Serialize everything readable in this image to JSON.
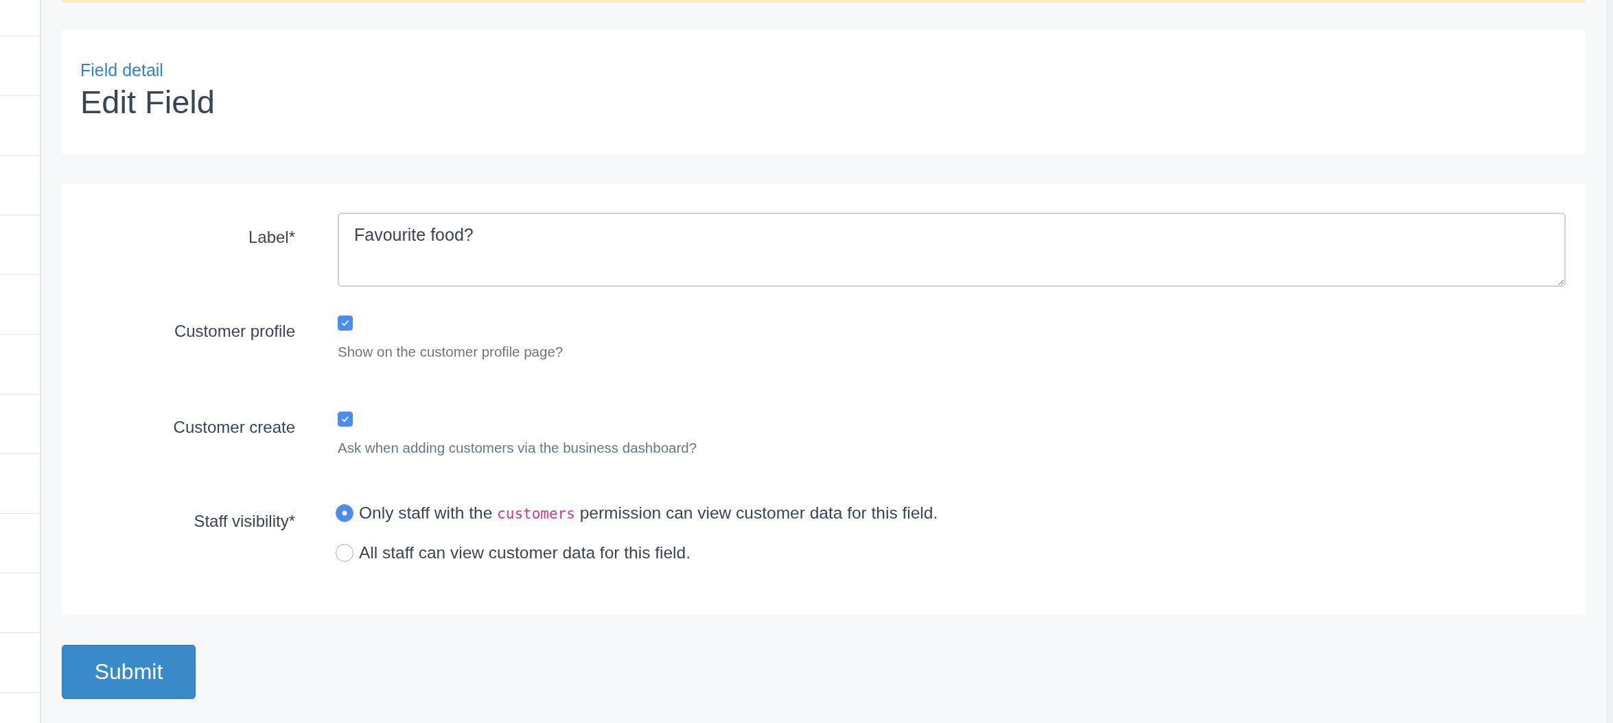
{
  "header": {
    "breadcrumb": "Field detail",
    "title": "Edit Field"
  },
  "form": {
    "label_field": {
      "label": "Label*",
      "value": "Favourite food?"
    },
    "checkboxes": [
      {
        "label": "Customer profile",
        "checked": true,
        "help": "Show on the customer profile page?"
      },
      {
        "label": "Customer create",
        "checked": true,
        "help": "Ask when adding customers via the business dashboard?"
      }
    ],
    "staff_visibility": {
      "label": "Staff visibility*",
      "options": [
        {
          "selected": true,
          "parts": [
            {
              "kind": "text",
              "text": "Only staff with the "
            },
            {
              "kind": "code",
              "text": "customers"
            },
            {
              "kind": "text",
              "text": " permission can view customer data for this field."
            }
          ]
        },
        {
          "selected": false,
          "parts": [
            {
              "kind": "text",
              "text": "All staff can view customer data for this field."
            }
          ]
        }
      ]
    }
  },
  "submit": "Submit"
}
